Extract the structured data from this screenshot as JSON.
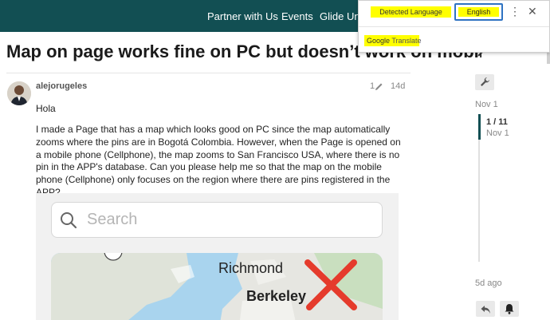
{
  "nav": {
    "items": [
      "Partner with Us",
      "Events",
      "Glide Uni"
    ]
  },
  "topic": {
    "title": "Map on page works fine on PC but doesn’t work on mobile"
  },
  "post": {
    "username": "alejorugeles",
    "edit_count": "1",
    "age": "14d",
    "greeting": "Hola",
    "body": "I made a Page that has a map which looks good on PC since the map automatically zooms where the pins are in Bogotá Colombia. However, when the Page is opened on a mobile phone (Cellphone), the map zooms to San Francisco USA, where there is no pin in the APP's database. Can you please help me so that the map on the mobile phone (Cellphone) only focuses on the region where there are pins registered in the APP?"
  },
  "embed": {
    "search_placeholder": "Search",
    "map_labels": [
      "Richmond",
      "Berkeley"
    ]
  },
  "timeline": {
    "start_date": "Nov 1",
    "position": "1 / 11",
    "position_date": "Nov 1",
    "end_label": "5d ago"
  },
  "translate": {
    "detected": "Detected Language",
    "target": "English",
    "brand_google": "Google",
    "brand_translate": "Translate"
  },
  "colors": {
    "header_bg": "#124f53",
    "highlight": "#ffff00",
    "selection_border": "#2f73c2",
    "red_x": "#e53b2c"
  }
}
